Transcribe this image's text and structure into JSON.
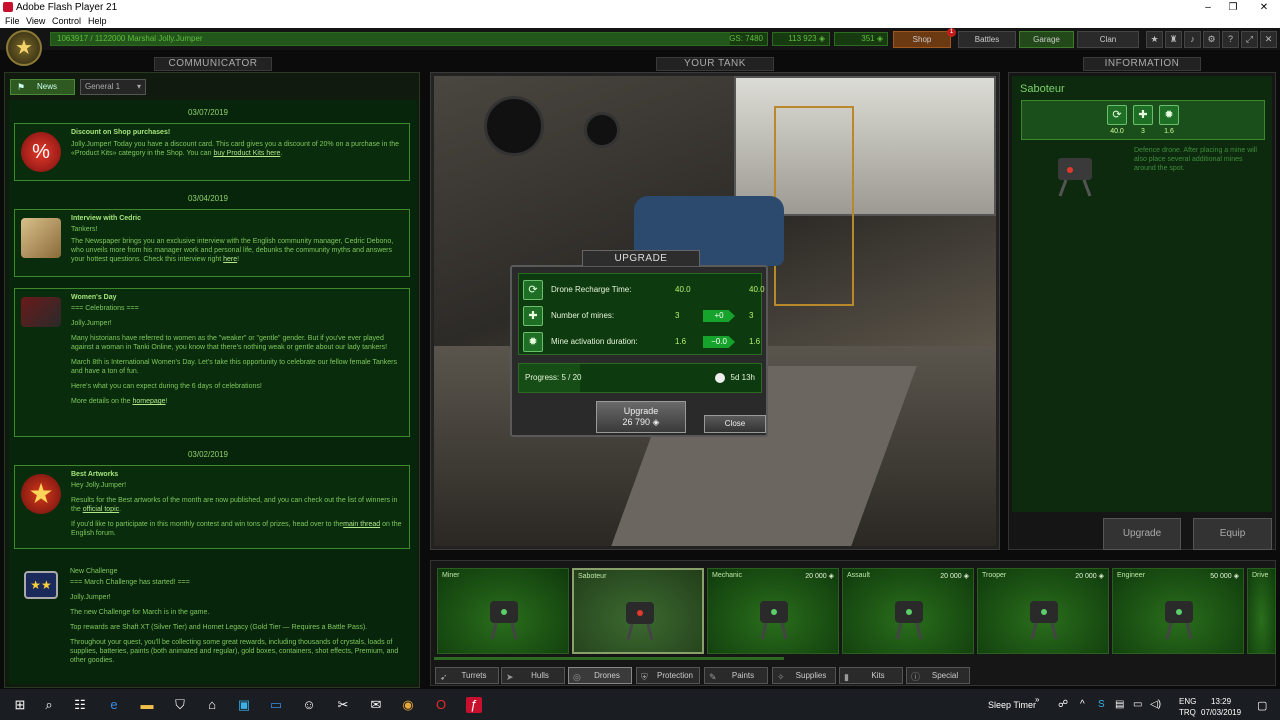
{
  "window": {
    "title": "Adobe Flash Player 21",
    "controls": [
      "–",
      "❐",
      "✕"
    ]
  },
  "menu": [
    "File",
    "View",
    "Control",
    "Help"
  ],
  "topbar": {
    "xp_text": "1063917 / 1122000   Marshal Jolly.Jumper",
    "xp_progress": 0.948,
    "gs": "GS: 7480",
    "crystals": "113 923 ◈",
    "rubies": "351 ◈",
    "nav": {
      "shop": "Shop",
      "battles": "Battles",
      "garage": "Garage",
      "clan": "Clan"
    },
    "shop_badge": "1"
  },
  "communicator": {
    "header": "COMMUNICATOR",
    "news_button": "News",
    "channel": "General 1",
    "feed": [
      {
        "date": "03/07/2019"
      },
      {
        "title": "Discount on Shop purchases!",
        "body": "Jolly.Jumper! Today you have a discount card. This card gives you a discount of 20% on a purchase in the «Product Kits» category in the Shop. You can ",
        "link": "buy Product Kits here",
        "after": "."
      },
      {
        "date": "03/04/2019"
      },
      {
        "title": "Interview with Cedric",
        "lead": "Tankers!",
        "body": "The Newspaper brings you an exclusive interview with the English community manager, Cedric Debono, who unveils more from his manager work and personal life, debunks the community myths and answers your hottest questions. Check this interview right ",
        "link": "here",
        "after": "!"
      },
      {
        "title": "Women's Day",
        "lead": "=== Celebrations ===",
        "greet": "Jolly.Jumper!",
        "p1": "Many historians have referred to women as the \"weaker\" or \"gentle\" gender. But if you've ever played against a woman in Tanki Online, you know that there's nothing weak or gentle about our lady tankers!",
        "p2": "March 8th is International Women's Day. Let's take this opportunity to celebrate our fellow female Tankers and have a ton of fun.",
        "p3": "Here's what you can expect during the 6 days of celebrations!",
        "p4": "More details on the ",
        "link": "homepage",
        "after": "!"
      },
      {
        "date": "03/02/2019"
      },
      {
        "title": "Best Artworks",
        "lead": "Hey Jolly.Jumper!",
        "body": "Results for the Best artworks of the month are now published, and you can check out the list of winners in the ",
        "link": "official topic",
        "after": ".",
        "p2": "If you'd like to participate in this monthly contest and win tons of prizes, head over to the",
        "link2": "main thread",
        "after2": " on the English forum."
      },
      {
        "title": "New Challenge",
        "lead": "=== March Challenge has started! ===",
        "greet": "Jolly.Jumper!",
        "p1": "The new Challenge for March is in the game.",
        "p2": "Top rewards are Shaft XT (Silver Tier) and Hornet Legacy (Gold Tier — Requires a Battle Pass).",
        "p3": "Throughout your quest, you'll be collecting some great rewards, including thousands of crystals, loads of supplies, batteries, paints (both animated and regular), gold boxes, containers, shot effects, Premium, and other goodies."
      }
    ]
  },
  "your_tank": {
    "header": "YOUR TANK"
  },
  "upgrade": {
    "header": "UPGRADE",
    "stats": [
      {
        "label": "Drone Recharge Time:",
        "current": "40.0",
        "delta": "",
        "next": "40.0",
        "icon": "⟳"
      },
      {
        "label": "Number of mines:",
        "current": "3",
        "delta": "+0",
        "next": "3",
        "icon": "✚"
      },
      {
        "label": "Mine activation duration:",
        "current": "1.6",
        "delta": "−0.0",
        "next": "1.6",
        "icon": "✹"
      }
    ],
    "progress_label": "Progress:  5 / 20",
    "progress": 0.25,
    "time_left": "5d 13h",
    "upgrade_button": "Upgrade",
    "upgrade_cost": "26 790 ◈",
    "close_button": "Close"
  },
  "information": {
    "header": "INFORMATION",
    "name": "Saboteur",
    "stats": [
      "40.0",
      "3",
      "1.6"
    ],
    "description": "Defence drone. After placing a mine will also place several additional mines around the spot.",
    "upgrade_button": "Upgrade",
    "equip_button": "Equip"
  },
  "items": [
    {
      "name": "Miner",
      "price": "",
      "selected": false
    },
    {
      "name": "Saboteur",
      "price": "",
      "selected": true
    },
    {
      "name": "Mechanic",
      "price": "20 000 ◈",
      "selected": false
    },
    {
      "name": "Assault",
      "price": "20 000 ◈",
      "selected": false
    },
    {
      "name": "Trooper",
      "price": "20 000 ◈",
      "selected": false
    },
    {
      "name": "Engineer",
      "price": "50 000 ◈",
      "selected": false
    },
    {
      "name": "Drive",
      "price": "",
      "selected": false
    }
  ],
  "tabs": [
    "Turrets",
    "Hulls",
    "Drones",
    "Protection",
    "Paints",
    "Supplies",
    "Kits",
    "Special"
  ],
  "active_tab": "Drones",
  "taskbar": {
    "sleep_timer": "Sleep Timer",
    "lang1": "ENG",
    "lang2": "TRQ",
    "time": "13:29",
    "date": "07/03/2019"
  },
  "colors": {
    "accent_green": "#3f8a2c",
    "shop_orange": "#6b3a12",
    "feed_bg": "#07250b"
  }
}
